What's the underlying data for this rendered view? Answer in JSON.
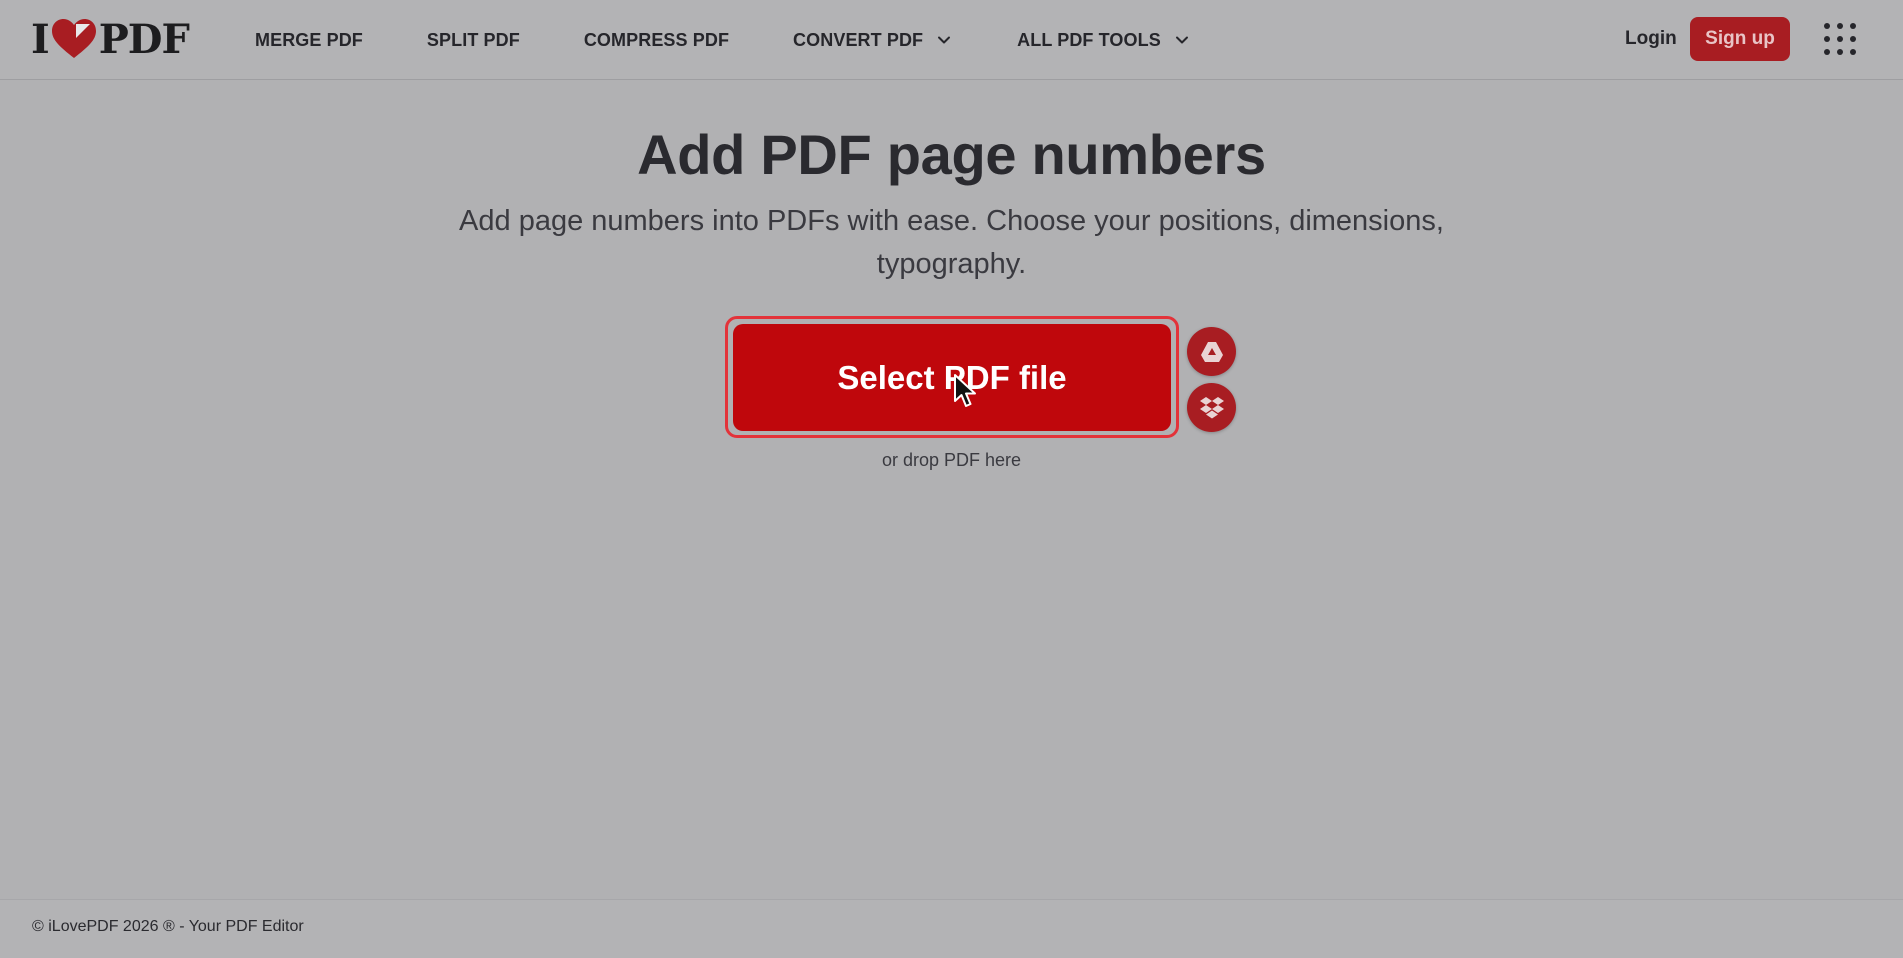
{
  "brand": {
    "logo_left": "I",
    "logo_right": "PDF",
    "accent_color": "#bf070c"
  },
  "nav": {
    "items": [
      {
        "label": "MERGE PDF",
        "has_dropdown": false
      },
      {
        "label": "SPLIT PDF",
        "has_dropdown": false
      },
      {
        "label": "COMPRESS PDF",
        "has_dropdown": false
      },
      {
        "label": "CONVERT PDF",
        "has_dropdown": true
      },
      {
        "label": "ALL PDF TOOLS",
        "has_dropdown": true
      }
    ]
  },
  "account": {
    "login_label": "Login",
    "signup_label": "Sign up"
  },
  "icons": {
    "apps": "apps-grid-icon",
    "gdrive": "google-drive-icon",
    "dropbox": "dropbox-icon",
    "chevron": "chevron-down-icon",
    "cursor": "mouse-pointer-icon"
  },
  "main": {
    "title": "Add PDF page numbers",
    "subtitle": "Add page numbers into PDFs with ease. Choose your positions, dimensions, typography.",
    "select_button": "Select PDF file",
    "drop_hint": "or drop PDF here"
  },
  "footer": {
    "text": "© iLovePDF 2026 ® - Your PDF Editor"
  }
}
